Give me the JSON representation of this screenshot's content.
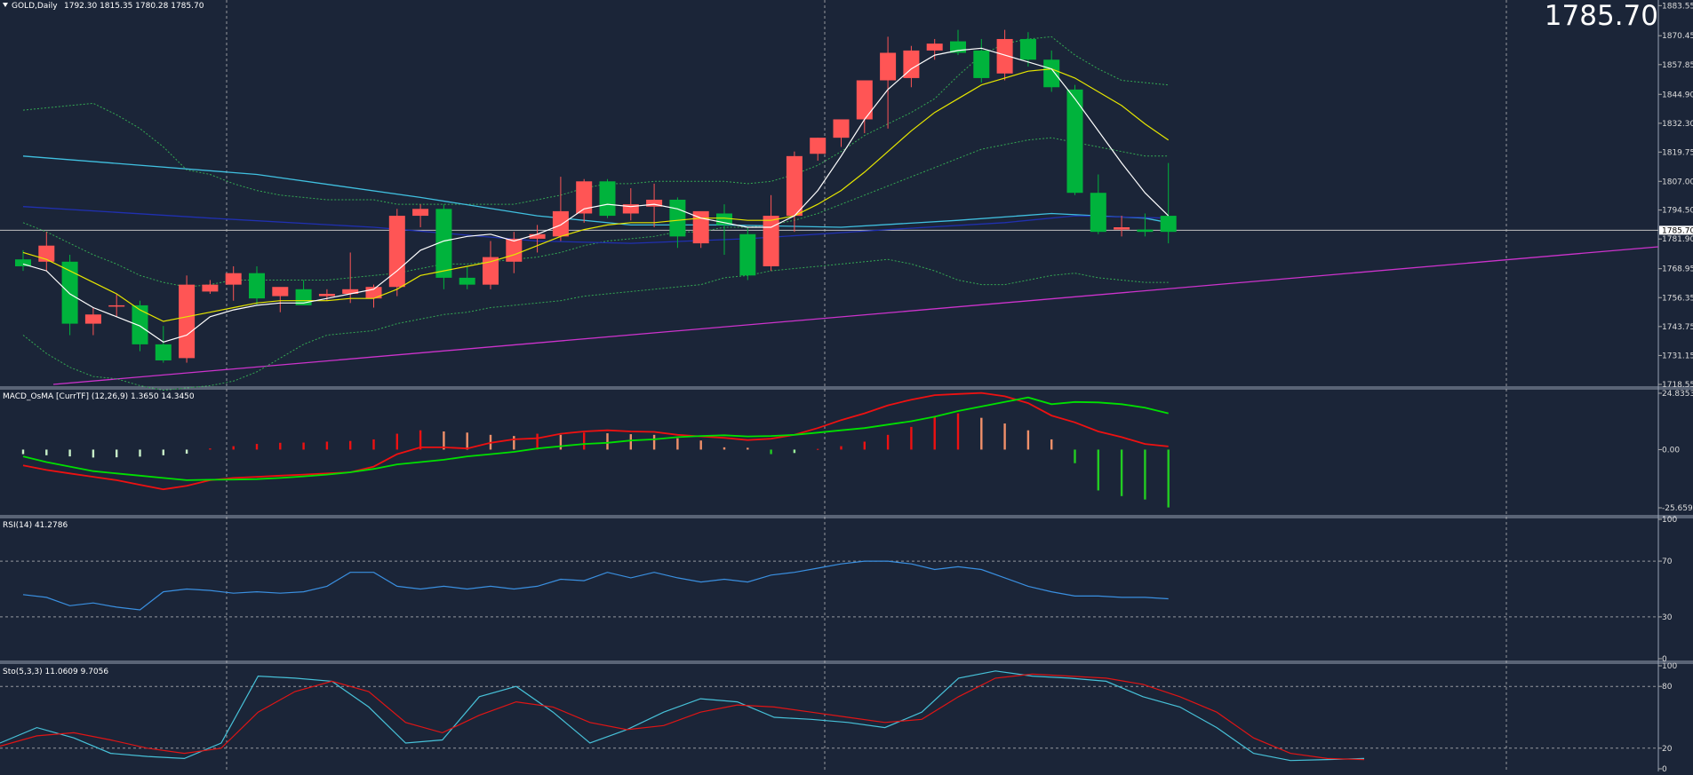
{
  "header": {
    "symbol_label": "GOLD,Daily",
    "ohlc_text": "1792.30 1815.35 1780.28 1785.70",
    "last_price_big": "1785.70"
  },
  "colors": {
    "background": "#1b2538",
    "bull_candle": "#00b33c",
    "bear_candle": "#ff5555",
    "grid": "#c8c8c8",
    "price_axis_text": "#dddddd",
    "ma_white": "#ffffff",
    "ma_yellow": "#e6e600",
    "ma_cyan": "#40c0e0",
    "ma_blue": "#2030b0",
    "bollinger": "#34a853",
    "trendline": "#cc33cc",
    "macd_signal_green": "#00e000",
    "macd_line_red": "#ee1111",
    "rsi_line": "#3a8fe0",
    "stoch_main": "#47c1d8",
    "stoch_signal": "#e01515"
  },
  "chart_data": [
    {
      "type": "candlestick",
      "title": "GOLD,Daily",
      "y_ticks": [
        1883.55,
        1870.45,
        1857.85,
        1844.9,
        1832.3,
        1819.75,
        1807.0,
        1794.5,
        1781.9,
        1768.95,
        1756.35,
        1743.75,
        1731.15,
        1718.55
      ],
      "ylim": [
        1718.55,
        1886.0
      ],
      "last_price": 1785.7,
      "candles": [
        {
          "o": 1773,
          "h": 1777,
          "l": 1768,
          "c": 1770
        },
        {
          "o": 1772,
          "h": 1785,
          "l": 1768,
          "c": 1779
        },
        {
          "o": 1772,
          "h": 1775,
          "l": 1740,
          "c": 1745
        },
        {
          "o": 1745,
          "h": 1752,
          "l": 1740,
          "c": 1749
        },
        {
          "o": 1753,
          "h": 1758,
          "l": 1748,
          "c": 1753
        },
        {
          "o": 1753,
          "h": 1755,
          "l": 1733,
          "c": 1736
        },
        {
          "o": 1736,
          "h": 1744,
          "l": 1728,
          "c": 1729
        },
        {
          "o": 1730,
          "h": 1766,
          "l": 1728,
          "c": 1762
        },
        {
          "o": 1759,
          "h": 1764,
          "l": 1758,
          "c": 1762
        },
        {
          "o": 1762,
          "h": 1770,
          "l": 1755,
          "c": 1767
        },
        {
          "o": 1767,
          "h": 1770,
          "l": 1753,
          "c": 1756
        },
        {
          "o": 1757,
          "h": 1760,
          "l": 1750,
          "c": 1761
        },
        {
          "o": 1760,
          "h": 1764,
          "l": 1754,
          "c": 1753
        },
        {
          "o": 1757,
          "h": 1760,
          "l": 1755,
          "c": 1758
        },
        {
          "o": 1758,
          "h": 1776,
          "l": 1754,
          "c": 1760
        },
        {
          "o": 1756,
          "h": 1762,
          "l": 1752,
          "c": 1761
        },
        {
          "o": 1761,
          "h": 1795,
          "l": 1757,
          "c": 1792
        },
        {
          "o": 1792,
          "h": 1797,
          "l": 1787,
          "c": 1795
        },
        {
          "o": 1795,
          "h": 1797,
          "l": 1760,
          "c": 1765
        },
        {
          "o": 1765,
          "h": 1770,
          "l": 1760,
          "c": 1762
        },
        {
          "o": 1762,
          "h": 1781,
          "l": 1760,
          "c": 1774
        },
        {
          "o": 1772,
          "h": 1785,
          "l": 1767,
          "c": 1782
        },
        {
          "o": 1782,
          "h": 1788,
          "l": 1776,
          "c": 1784
        },
        {
          "o": 1783,
          "h": 1809,
          "l": 1781,
          "c": 1794
        },
        {
          "o": 1793,
          "h": 1808,
          "l": 1789,
          "c": 1807
        },
        {
          "o": 1807,
          "h": 1808,
          "l": 1791,
          "c": 1792
        },
        {
          "o": 1793,
          "h": 1804,
          "l": 1790,
          "c": 1797
        },
        {
          "o": 1796,
          "h": 1806,
          "l": 1787,
          "c": 1799
        },
        {
          "o": 1799,
          "h": 1800,
          "l": 1778,
          "c": 1783
        },
        {
          "o": 1780,
          "h": 1793,
          "l": 1778,
          "c": 1794
        },
        {
          "o": 1793,
          "h": 1797,
          "l": 1775,
          "c": 1788
        },
        {
          "o": 1784,
          "h": 1787,
          "l": 1764,
          "c": 1766
        },
        {
          "o": 1770,
          "h": 1801,
          "l": 1768,
          "c": 1792
        },
        {
          "o": 1792,
          "h": 1820,
          "l": 1785,
          "c": 1818
        },
        {
          "o": 1819,
          "h": 1826,
          "l": 1816,
          "c": 1826
        },
        {
          "o": 1826,
          "h": 1832,
          "l": 1822,
          "c": 1834
        },
        {
          "o": 1834,
          "h": 1851,
          "l": 1828,
          "c": 1851
        },
        {
          "o": 1851,
          "h": 1870,
          "l": 1830,
          "c": 1863
        },
        {
          "o": 1852,
          "h": 1866,
          "l": 1848,
          "c": 1864
        },
        {
          "o": 1864,
          "h": 1869,
          "l": 1860,
          "c": 1867
        },
        {
          "o": 1868,
          "h": 1873,
          "l": 1862,
          "c": 1863
        },
        {
          "o": 1864,
          "h": 1869,
          "l": 1850,
          "c": 1852
        },
        {
          "o": 1854,
          "h": 1873,
          "l": 1851,
          "c": 1869
        },
        {
          "o": 1869,
          "h": 1872,
          "l": 1857,
          "c": 1860
        },
        {
          "o": 1860,
          "h": 1864,
          "l": 1846,
          "c": 1848
        },
        {
          "o": 1847,
          "h": 1849,
          "l": 1801,
          "c": 1802
        },
        {
          "o": 1802,
          "h": 1810,
          "l": 1784,
          "c": 1785
        },
        {
          "o": 1786,
          "h": 1792,
          "l": 1783,
          "c": 1787
        },
        {
          "o": 1786,
          "h": 1793,
          "l": 1783,
          "c": 1785
        },
        {
          "o": 1792,
          "h": 1815,
          "l": 1780,
          "c": 1785
        }
      ],
      "ma_white": [
        1771,
        1768,
        1758,
        1752,
        1748,
        1744,
        1737,
        1740,
        1748,
        1751,
        1753,
        1754,
        1754,
        1756,
        1758,
        1760,
        1768,
        1777,
        1781,
        1783,
        1784,
        1781,
        1784,
        1788,
        1795,
        1797,
        1796,
        1797,
        1795,
        1791,
        1789,
        1787,
        1787,
        1792,
        1803,
        1818,
        1834,
        1847,
        1856,
        1862,
        1864,
        1865,
        1862,
        1859,
        1856,
        1843,
        1829,
        1815,
        1802,
        1792
      ],
      "ma_yellow": [
        1776,
        1773,
        1768,
        1763,
        1758,
        1751,
        1746,
        1748,
        1750,
        1752,
        1754,
        1755,
        1755,
        1755,
        1756,
        1756,
        1760,
        1766,
        1768,
        1770,
        1772,
        1775,
        1779,
        1783,
        1786,
        1788,
        1789,
        1789,
        1790,
        1791,
        1791,
        1790,
        1790,
        1792,
        1797,
        1803,
        1811,
        1820,
        1829,
        1837,
        1843,
        1849,
        1852,
        1855,
        1856,
        1852,
        1846,
        1840,
        1832,
        1825
      ],
      "ma_cyan_points": [
        [
          0,
          1818
        ],
        [
          10,
          1810
        ],
        [
          17,
          1800
        ],
        [
          22,
          1792
        ],
        [
          26,
          1788
        ],
        [
          30,
          1788
        ],
        [
          35,
          1787
        ],
        [
          40,
          1790
        ],
        [
          44,
          1793
        ],
        [
          48,
          1791
        ],
        [
          49,
          1789
        ]
      ],
      "ma_blue_points": [
        [
          0,
          1796
        ],
        [
          8,
          1791
        ],
        [
          15,
          1787
        ],
        [
          22,
          1781
        ],
        [
          26,
          1780
        ],
        [
          31,
          1782
        ],
        [
          37,
          1786
        ],
        [
          42,
          1789
        ],
        [
          45,
          1792
        ],
        [
          49,
          1791
        ]
      ],
      "bollinger_upper": [
        1838,
        1839,
        1840,
        1841,
        1836,
        1830,
        1822,
        1812,
        1810,
        1806,
        1803,
        1801,
        1800,
        1799,
        1799,
        1799,
        1797,
        1797,
        1797,
        1797,
        1797,
        1797,
        1799,
        1801,
        1804,
        1806,
        1806,
        1807,
        1807,
        1807,
        1807,
        1806,
        1807,
        1810,
        1814,
        1820,
        1827,
        1832,
        1837,
        1843,
        1853,
        1862,
        1867,
        1869,
        1870,
        1862,
        1856,
        1851,
        1850,
        1849
      ],
      "bollinger_middle": [
        1789,
        1785,
        1780,
        1775,
        1771,
        1766,
        1763,
        1761,
        1762,
        1764,
        1764,
        1764,
        1764,
        1764,
        1765,
        1766,
        1767,
        1769,
        1771,
        1771,
        1772,
        1773,
        1774,
        1776,
        1779,
        1781,
        1782,
        1783,
        1785,
        1785,
        1787,
        1787,
        1788,
        1790,
        1793,
        1797,
        1801,
        1805,
        1809,
        1813,
        1817,
        1821,
        1823,
        1825,
        1826,
        1824,
        1822,
        1820,
        1818,
        1818
      ],
      "bollinger_lower": [
        1740,
        1732,
        1726,
        1722,
        1721,
        1718,
        1716,
        1717,
        1718,
        1720,
        1724,
        1730,
        1736,
        1740,
        1741,
        1742,
        1745,
        1747,
        1749,
        1750,
        1752,
        1753,
        1754,
        1755,
        1757,
        1758,
        1759,
        1760,
        1761,
        1762,
        1765,
        1766,
        1768,
        1769,
        1770,
        1771,
        1772,
        1773,
        1771,
        1768,
        1764,
        1762,
        1762,
        1764,
        1766,
        1767,
        1765,
        1764,
        1763,
        1763
      ],
      "trendline": [
        [
          1718.55,
          1778.5
        ]
      ]
    },
    {
      "type": "bar",
      "title": "MACD_OsMA [CurrTF] (12,26,9) 1.3650 14.3450",
      "y_ticks": [
        24.8353,
        0.0,
        -25.6592
      ],
      "ylim": [
        -28,
        26
      ],
      "histogram": [
        -2.0,
        -2.5,
        -3.0,
        -3.5,
        -3.4,
        -3.1,
        -2.5,
        -1.8,
        0.5,
        1.5,
        2.5,
        3.0,
        3.1,
        3.5,
        3.8,
        4.5,
        7.0,
        8.5,
        8.0,
        7.5,
        6.5,
        6.0,
        7.0,
        6.5,
        7.5,
        7.2,
        6.8,
        6.5,
        5.0,
        4.0,
        1.0,
        0.8,
        -2.0,
        -1.5,
        0.3,
        1.5,
        3.5,
        6.5,
        10.0,
        14.5,
        16.0,
        14.0,
        11.5,
        8.5,
        4.5,
        -6.0,
        -18.0,
        -20.5,
        -22.0,
        -25.5
      ],
      "macd_red": [
        -7.0,
        -9.0,
        -10.5,
        -12.0,
        -13.5,
        -15.5,
        -17.5,
        -16.0,
        -13.5,
        -12.5,
        -12.0,
        -11.5,
        -11.0,
        -10.5,
        -10.0,
        -7.5,
        -2.0,
        1.0,
        1.0,
        0.5,
        3.0,
        4.5,
        5.0,
        7.0,
        8.0,
        8.5,
        8.0,
        7.8,
        6.5,
        5.8,
        5.2,
        4.2,
        4.8,
        6.5,
        9.5,
        13.0,
        16.0,
        19.5,
        22.0,
        24.0,
        24.5,
        25.0,
        23.5,
        20.5,
        15.0,
        12.0,
        8.0,
        5.5,
        2.5,
        1.4
      ],
      "signal_green": [
        -3.0,
        -5.5,
        -7.5,
        -9.5,
        -10.5,
        -11.5,
        -12.5,
        -13.5,
        -13.3,
        -13.2,
        -13.0,
        -12.5,
        -11.8,
        -11.0,
        -10.0,
        -8.5,
        -6.5,
        -5.5,
        -4.5,
        -3.0,
        -2.0,
        -1.0,
        0.5,
        1.5,
        2.5,
        3.0,
        4.0,
        4.5,
        5.5,
        6.0,
        6.3,
        5.8,
        6.0,
        6.5,
        7.5,
        8.5,
        9.5,
        11.0,
        12.5,
        14.5,
        17.0,
        19.0,
        21.0,
        23.0,
        20.0,
        21.0,
        20.8,
        20.0,
        18.5,
        16.0
      ]
    },
    {
      "type": "line",
      "title": "RSI(14) 41.2786",
      "y_ticks": [
        100,
        70,
        30,
        0
      ],
      "ylim": [
        0,
        100
      ],
      "values": [
        46,
        44,
        38,
        40,
        37,
        35,
        48,
        50,
        49,
        47,
        48,
        47,
        48,
        52,
        62,
        62,
        52,
        50,
        52,
        50,
        52,
        50,
        52,
        57,
        56,
        62,
        58,
        62,
        58,
        55,
        57,
        55,
        60,
        62,
        65,
        68,
        70,
        70,
        68,
        64,
        66,
        64,
        58,
        52,
        48,
        45,
        45,
        44,
        44,
        43
      ]
    },
    {
      "type": "line",
      "title": "Sto(5,3,3) 11.0609 9.7056",
      "y_ticks": [
        100,
        80,
        20,
        0
      ],
      "ylim": [
        0,
        100
      ],
      "main": [
        25,
        40,
        30,
        15,
        12,
        10,
        25,
        90,
        88,
        85,
        60,
        25,
        28,
        70,
        80,
        55,
        25,
        38,
        55,
        68,
        65,
        50,
        48,
        45,
        40,
        55,
        88,
        95,
        90,
        88,
        85,
        70,
        60,
        40,
        15,
        8,
        9,
        10
      ],
      "signal": [
        22,
        32,
        35,
        28,
        20,
        15,
        20,
        55,
        75,
        85,
        75,
        45,
        35,
        52,
        65,
        60,
        45,
        38,
        42,
        55,
        62,
        60,
        55,
        50,
        45,
        48,
        70,
        88,
        92,
        90,
        88,
        82,
        70,
        55,
        30,
        15,
        10,
        9
      ]
    }
  ]
}
